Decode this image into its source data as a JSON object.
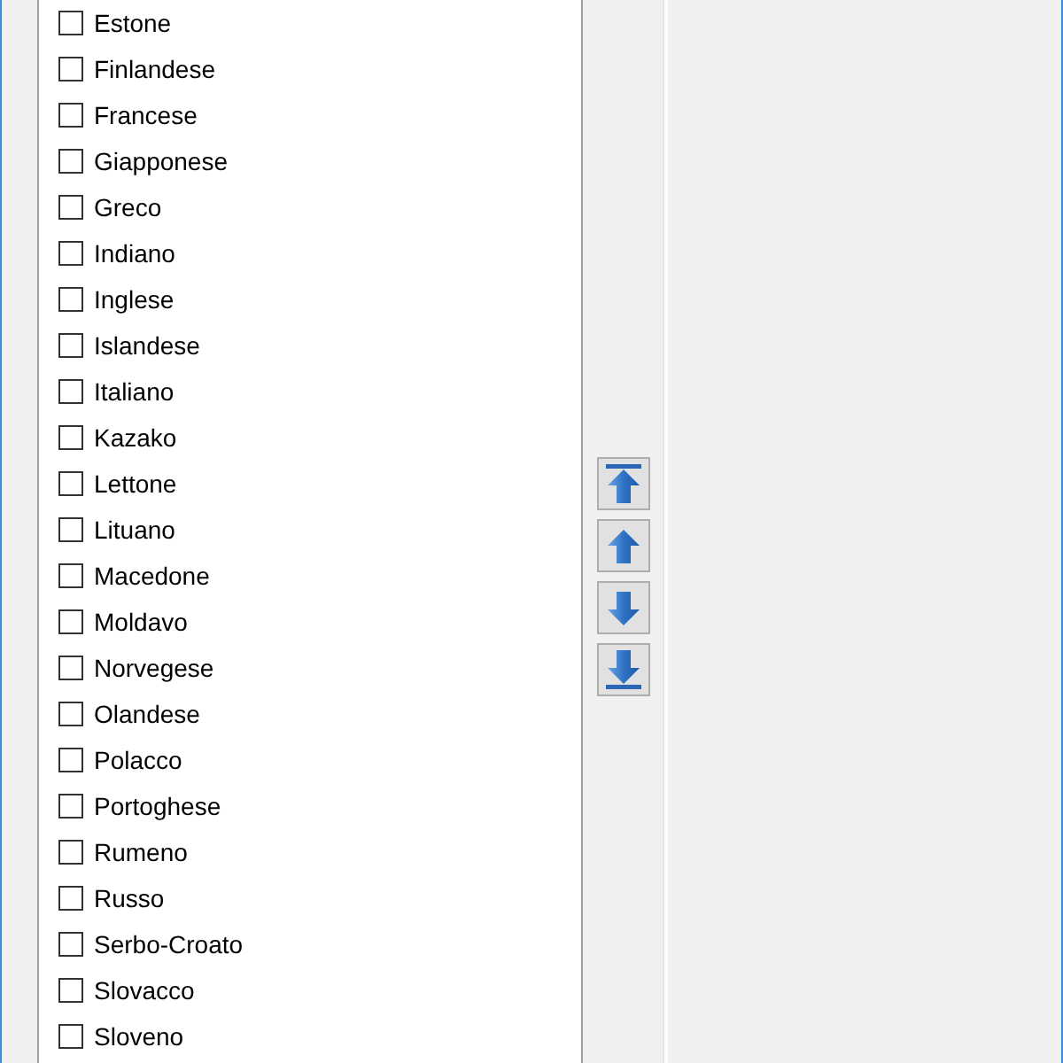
{
  "language_list": {
    "items": [
      {
        "label": "Estone",
        "checked": false
      },
      {
        "label": "Finlandese",
        "checked": false
      },
      {
        "label": "Francese",
        "checked": false
      },
      {
        "label": "Giapponese",
        "checked": false
      },
      {
        "label": "Greco",
        "checked": false
      },
      {
        "label": "Indiano",
        "checked": false
      },
      {
        "label": "Inglese",
        "checked": false
      },
      {
        "label": "Islandese",
        "checked": false
      },
      {
        "label": "Italiano",
        "checked": false
      },
      {
        "label": "Kazako",
        "checked": false
      },
      {
        "label": "Lettone",
        "checked": false
      },
      {
        "label": "Lituano",
        "checked": false
      },
      {
        "label": "Macedone",
        "checked": false
      },
      {
        "label": "Moldavo",
        "checked": false
      },
      {
        "label": "Norvegese",
        "checked": false
      },
      {
        "label": "Olandese",
        "checked": false
      },
      {
        "label": "Polacco",
        "checked": false
      },
      {
        "label": "Portoghese",
        "checked": false
      },
      {
        "label": "Rumeno",
        "checked": false
      },
      {
        "label": "Russo",
        "checked": false
      },
      {
        "label": "Serbo-Croato",
        "checked": false
      },
      {
        "label": "Slovacco",
        "checked": false
      },
      {
        "label": "Sloveno",
        "checked": false
      }
    ]
  }
}
